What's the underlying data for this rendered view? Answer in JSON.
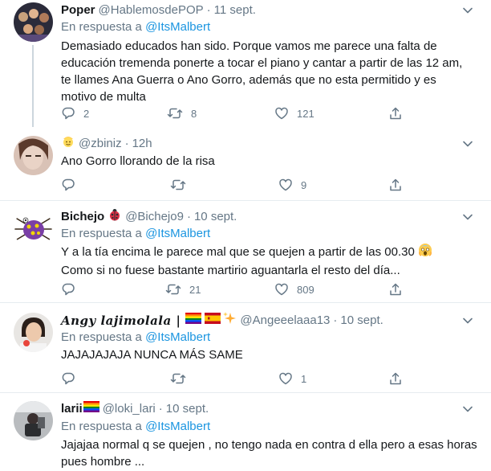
{
  "tweets": [
    {
      "name": "Poper",
      "handle": "@HablemosdePOP",
      "time": "11 sept.",
      "reply_prefix": "En respuesta a",
      "reply_mention": "@ItsMalbert",
      "text_lines": [
        "Demasiado educados han sido. Porque vamos me parece una falta de",
        "educación tremenda ponerte a tocar el piano y cantar a partir de las 12 am,",
        "te llames Ana Guerra o Ano Gorro, además que no esta permitido y es",
        "motivo de multa"
      ],
      "replies": "2",
      "retweets": "8",
      "likes": "121"
    },
    {
      "name": "",
      "handle": "@zbiniz",
      "time": "12h",
      "text_lines": [
        "Ano Gorro llorando de la risa"
      ],
      "replies": "",
      "retweets": "",
      "likes": "9"
    },
    {
      "name": "Bichejo",
      "handle": "@Bichejo9",
      "time": "10 sept.",
      "reply_prefix": "En respuesta a",
      "reply_mention": "@ItsMalbert",
      "text_lines": [
        "Y a la tía encima le parece mal que se quejen a partir de las 00.30",
        "Como si no fuese bastante martirio aguantarla el resto del día..."
      ],
      "replies": "",
      "retweets": "21",
      "likes": "809"
    },
    {
      "name": "𝑨𝒏𝒈𝒚 𝒍𝒂𝒋𝒊𝒎𝒐𝒍𝒂𝒍𝒂 |",
      "handle": "@Angeeelaaa13",
      "time": "10 sept.",
      "reply_prefix": "En respuesta a",
      "reply_mention": "@ItsMalbert",
      "text_lines": [
        "JAJAJAJAJA NUNCA MÁS SAME"
      ],
      "replies": "",
      "retweets": "",
      "likes": "1"
    },
    {
      "name": "larii",
      "handle": "@loki_lari",
      "time": "10 sept.",
      "reply_prefix": "En respuesta a",
      "reply_mention": "@ItsMalbert",
      "text_lines": [
        "Jajajaa normal q se quejen , no tengo nada en contra d ella pero a esas horas",
        "pues hombre ..."
      ]
    }
  ],
  "separator": "·",
  "icons": {
    "reply": "reply-icon",
    "retweet": "retweet-icon",
    "like": "heart-icon",
    "share": "share-icon",
    "more": "chevron-down-icon"
  },
  "colors": {
    "text": "#14171a",
    "secondary": "#657786",
    "link": "#1b95e0",
    "border": "#e6ecf0",
    "thread_line": "#ccd6dd"
  }
}
